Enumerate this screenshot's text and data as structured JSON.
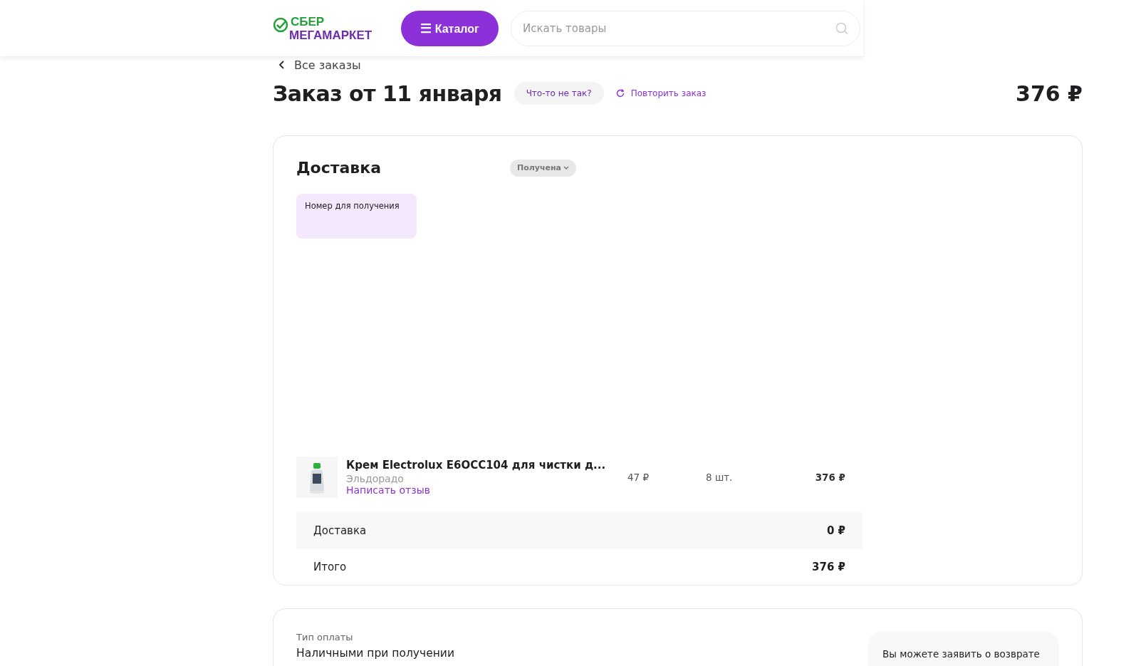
{
  "header": {
    "logo": {
      "line_1": "СБЕР",
      "line_2": "МЕГАМАРКЕТ"
    },
    "catalog_button": {
      "icon": "☰",
      "label": "Каталог"
    },
    "search": {
      "placeholder": "Искать товары"
    }
  },
  "back_link": "Все заказы",
  "order": {
    "title": "Заказ от 11 января",
    "problem_button": "Что-то не так?",
    "repeat_button": "Повторить заказ",
    "total": "376 ₽"
  },
  "delivery": {
    "title": "Доставка",
    "status": "Получена",
    "pickup_code_label": "Номер для получения",
    "items": [
      {
        "name": "Крем Electrolux E6OCC104 для чистки д...",
        "seller": "Эльдорадо",
        "review_link": "Написать отзыв",
        "price": "47 ₽",
        "quantity": "8 шт.",
        "sum": "376 ₽"
      }
    ],
    "summary": [
      {
        "label": "Доставка",
        "value": "0 ₽"
      },
      {
        "label": "Итого",
        "value": "376 ₽"
      }
    ]
  },
  "payment": {
    "label": "Тип оплаты",
    "value": "Наличными при получении",
    "return_note": "Вы можете заявить о возврате"
  }
}
